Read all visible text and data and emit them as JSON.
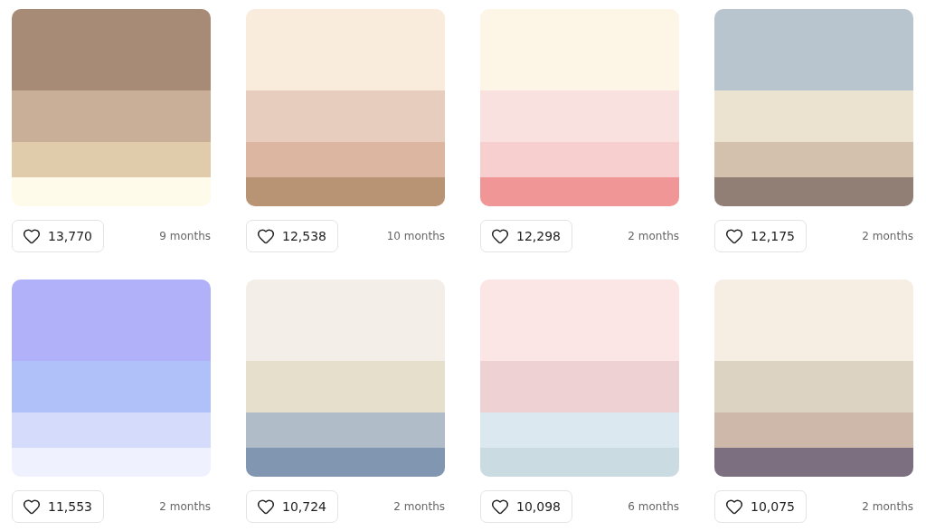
{
  "palettes": [
    {
      "colors": [
        {
          "color": "#a78b76"
        },
        {
          "color": "#c9ae98"
        },
        {
          "color": "#e0cbab"
        },
        {
          "color": "#fefbea"
        }
      ],
      "likes": "13,770",
      "age": "9 months"
    },
    {
      "colors": [
        {
          "color": "#faecdc"
        },
        {
          "color": "#e7cdbd"
        },
        {
          "color": "#dcb6a0"
        },
        {
          "color": "#b89474"
        }
      ],
      "likes": "12,538",
      "age": "10 months"
    },
    {
      "colors": [
        {
          "color": "#fdf5e6"
        },
        {
          "color": "#f8e1df"
        },
        {
          "color": "#f7cfcf"
        },
        {
          "color": "#f09696"
        }
      ],
      "likes": "12,298",
      "age": "2 months"
    },
    {
      "colors": [
        {
          "color": "#b8c4ce"
        },
        {
          "color": "#ebe3cf"
        },
        {
          "color": "#d3c1ae"
        },
        {
          "color": "#917f76"
        }
      ],
      "likes": "12,175",
      "age": "2 months"
    },
    {
      "colors": [
        {
          "color": "#b1b1f9"
        },
        {
          "color": "#b0c1fa"
        },
        {
          "color": "#d5dbfb"
        },
        {
          "color": "#eff1fe"
        }
      ],
      "likes": "11,553",
      "age": "2 months"
    },
    {
      "colors": [
        {
          "color": "#f3eee7"
        },
        {
          "color": "#e5dfcb"
        },
        {
          "color": "#b0bdc9"
        },
        {
          "color": "#8197b1"
        }
      ],
      "likes": "10,724",
      "age": "2 months"
    },
    {
      "colors": [
        {
          "color": "#fbe5e5"
        },
        {
          "color": "#edd1d3"
        },
        {
          "color": "#dce8ef"
        },
        {
          "color": "#cadce2"
        }
      ],
      "likes": "10,098",
      "age": "6 months"
    },
    {
      "colors": [
        {
          "color": "#f6ede3"
        },
        {
          "color": "#ddd3c3"
        },
        {
          "color": "#cdb8a9"
        },
        {
          "color": "#7c6f80"
        }
      ],
      "likes": "10,075",
      "age": "2 months"
    }
  ]
}
